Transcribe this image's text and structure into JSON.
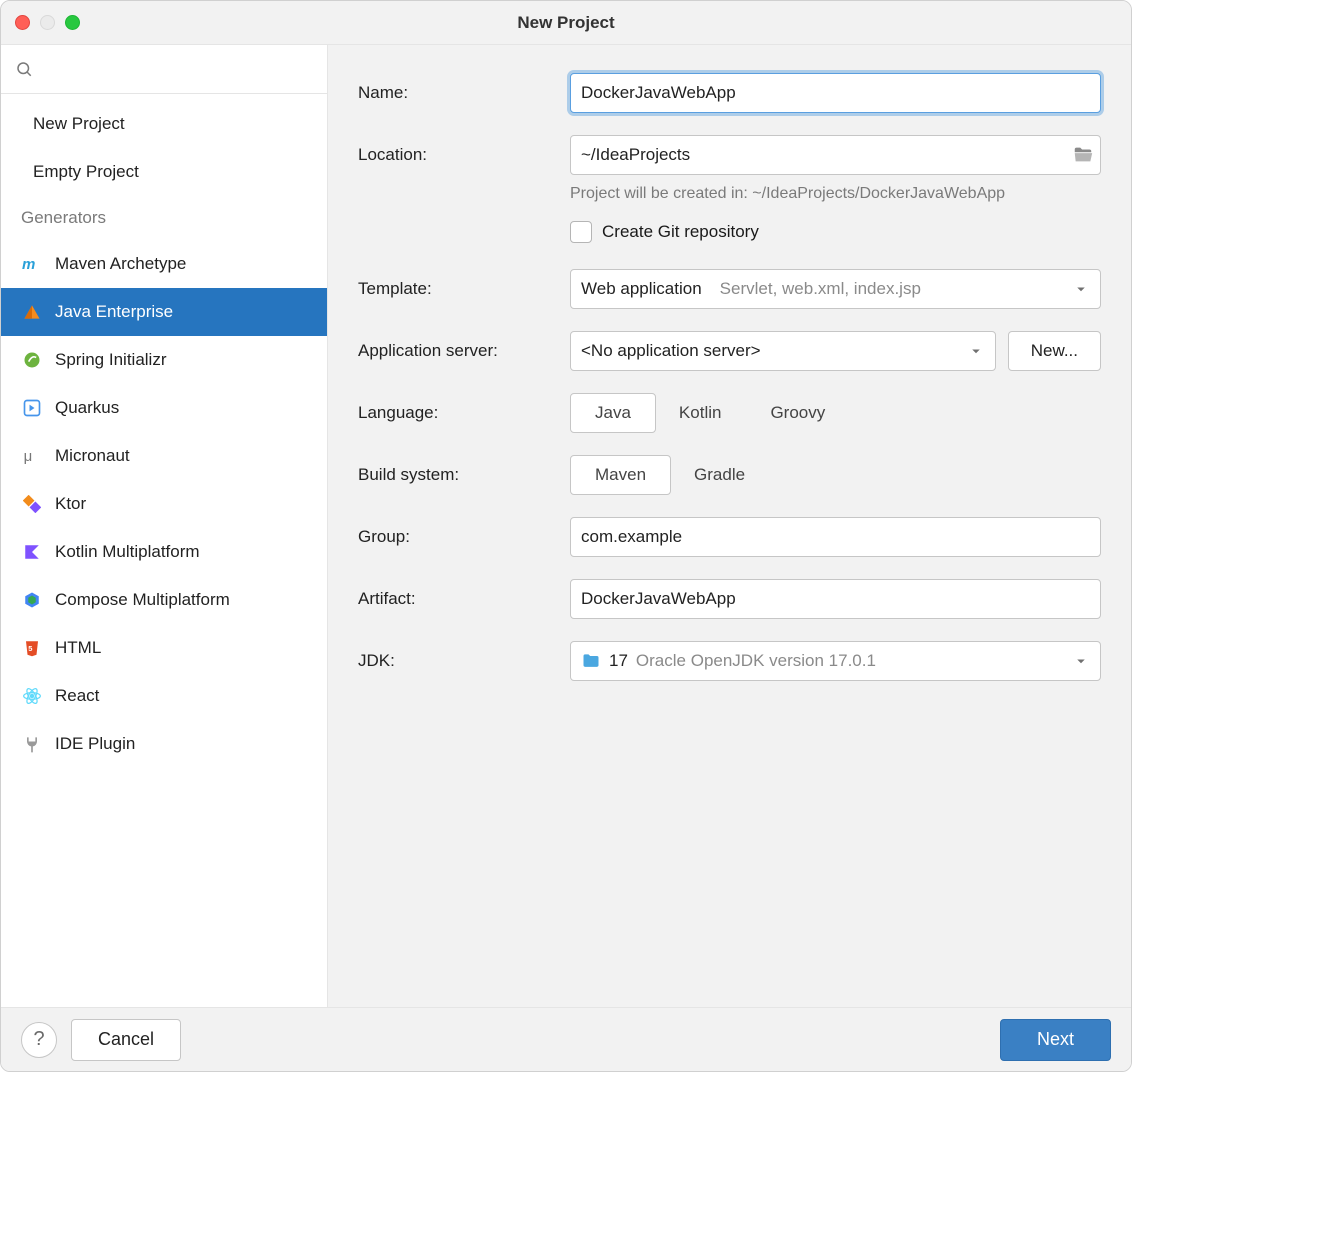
{
  "window": {
    "title": "New Project"
  },
  "sidebar": {
    "top": [
      "New Project",
      "Empty Project"
    ],
    "generatorsHeader": "Generators",
    "generators": [
      "Maven Archetype",
      "Java Enterprise",
      "Spring Initializr",
      "Quarkus",
      "Micronaut",
      "Ktor",
      "Kotlin Multiplatform",
      "Compose Multiplatform",
      "HTML",
      "React",
      "IDE Plugin"
    ],
    "selectedIndex": 1
  },
  "form": {
    "nameLabel": "Name:",
    "nameValue": "DockerJavaWebApp",
    "locationLabel": "Location:",
    "locationValue": "~/IdeaProjects",
    "locationHint": "Project will be created in: ~/IdeaProjects/DockerJavaWebApp",
    "gitCheckboxLabel": "Create Git repository",
    "templateLabel": "Template:",
    "templateValue": "Web application",
    "templateHint": "Servlet, web.xml, index.jsp",
    "appServerLabel": "Application server:",
    "appServerValue": "<No application server>",
    "newBtn": "New...",
    "languageLabel": "Language:",
    "languages": [
      "Java",
      "Kotlin",
      "Groovy"
    ],
    "languageSelected": 0,
    "buildLabel": "Build system:",
    "builds": [
      "Maven",
      "Gradle"
    ],
    "buildSelected": 0,
    "groupLabel": "Group:",
    "groupValue": "com.example",
    "artifactLabel": "Artifact:",
    "artifactValue": "DockerJavaWebApp",
    "jdkLabel": "JDK:",
    "jdkVersion": "17",
    "jdkDesc": "Oracle OpenJDK version 17.0.1"
  },
  "footer": {
    "cancel": "Cancel",
    "next": "Next"
  }
}
